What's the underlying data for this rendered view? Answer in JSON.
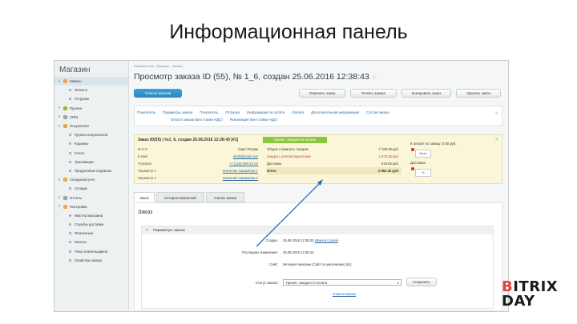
{
  "slide": {
    "title": "Информационная панель"
  },
  "brand": {
    "line1_a": "B",
    "line1_b": "ITRIX",
    "line2_a": "D",
    "line2_b": "AY",
    "accent": "#e3423d"
  },
  "sidebar": {
    "title": "Магазин",
    "items": [
      {
        "label": "Заказы",
        "level": 1,
        "icon": "cart-icon"
      },
      {
        "label": "Оплаты",
        "level": 2
      },
      {
        "label": "Отгрузки",
        "level": 2
      },
      {
        "label": "Прочее",
        "level": 1,
        "icon": "folder-icon"
      },
      {
        "label": "CRM",
        "level": 1,
        "icon": "crm-icon"
      },
      {
        "label": "Покупатели",
        "level": 1,
        "icon": "users-icon"
      },
      {
        "label": "Группы покупателей",
        "level": 2
      },
      {
        "label": "Корзины",
        "level": 2
      },
      {
        "label": "Счета",
        "level": 2
      },
      {
        "label": "Транзакции",
        "level": 2
      },
      {
        "label": "Продленные подписки",
        "level": 2
      },
      {
        "label": "Складской учет",
        "level": 1,
        "icon": "warehouse-icon"
      },
      {
        "label": "Склады",
        "level": 2
      },
      {
        "label": "Отчеты",
        "level": 1,
        "icon": "reports-icon"
      },
      {
        "label": "Настройки",
        "level": 1,
        "icon": "settings-icon"
      },
      {
        "label": "Мастер магазина",
        "level": 2
      },
      {
        "label": "Службы доставки",
        "level": 2
      },
      {
        "label": "Платежные",
        "level": 2
      },
      {
        "label": "Налоги",
        "level": 2
      },
      {
        "label": "Типы плательщиков",
        "level": 2
      },
      {
        "label": "Свойства заказа",
        "level": 2
      }
    ]
  },
  "header": {
    "breadcrumbs": "Рабочий стол  ›  Магазин  ›  Заказы",
    "title": "Просмотр заказа ID (55), № 1_6, создан 25.06.2016 12:38:43"
  },
  "toolbar": {
    "orders_list": "Список заказов",
    "edit": "Изменить заказ",
    "print": "Печать заказа",
    "copy": "Копировать заказ",
    "delete": "Удалить заказ"
  },
  "section_tabs": {
    "row1": [
      "Покупатель",
      "Параметры заказа",
      "Покупатель",
      "Отгрузка",
      "Информация по оплате",
      "Оплата",
      "Дополнительная информация",
      "Состав заказа"
    ],
    "row2": [
      "Оплата заказа (Без ставки НДС)",
      "Реализация (Без ставки НДС)"
    ]
  },
  "order_info": {
    "heading": "Заказ ID(55) | №1_6, создан 25.06.2016 12:38:43 [#1]",
    "paid_badge": "Принят, ожидается оплата",
    "customer": [
      {
        "k": "Ф.И.О.",
        "v": "Смит Петрик"
      },
      {
        "k": "E-Mail",
        "v": "smith@mail.com"
      },
      {
        "k": "Телефон",
        "v": "+7 (123) 890-12-34"
      },
      {
        "k": "Параметр 1",
        "v": "Значение параметра 1"
      },
      {
        "k": "Параметр 2",
        "v": "Значение параметра 2"
      }
    ],
    "totals": [
      {
        "k": "Общая стоимость товаров",
        "v": "7 158.00 руб."
      },
      {
        "k": "Скидка с учетом округления",
        "v": "1 573.25 руб."
      },
      {
        "k": "Доставка",
        "v": "519.00 руб."
      },
      {
        "k": "Итого",
        "v": "2 952.25 руб."
      }
    ],
    "side": {
      "to_pay": "К оплате по заказу: 0.00 руб.",
      "delivery": "Доставка:",
      "delivery_logo": "Boxb",
      "percent_logo": "%"
    }
  },
  "order_tabs": [
    "Заказ",
    "История изменений",
    "Анализ заказа"
  ],
  "order_pane": {
    "title": "Заказ",
    "params_header": "Параметры заказа",
    "rows": [
      {
        "k": "Создан:",
        "v": "25.06.2016 12:38:43 ",
        "link": "Иванов Сергей"
      },
      {
        "k": "Последнее изменение:",
        "v": "25.06.2016 12:38:43",
        "link": ""
      },
      {
        "k": "Сайт:",
        "v": "Интернет-магазин (Сайт по умолчанию) [s1]",
        "link": ""
      },
      {
        "k": "Статус заказа:",
        "v": "",
        "link": ""
      }
    ],
    "status_value": "Принят, ожидается оплата",
    "save_label": "Сохранить",
    "history_link": "Отмена заказа"
  }
}
